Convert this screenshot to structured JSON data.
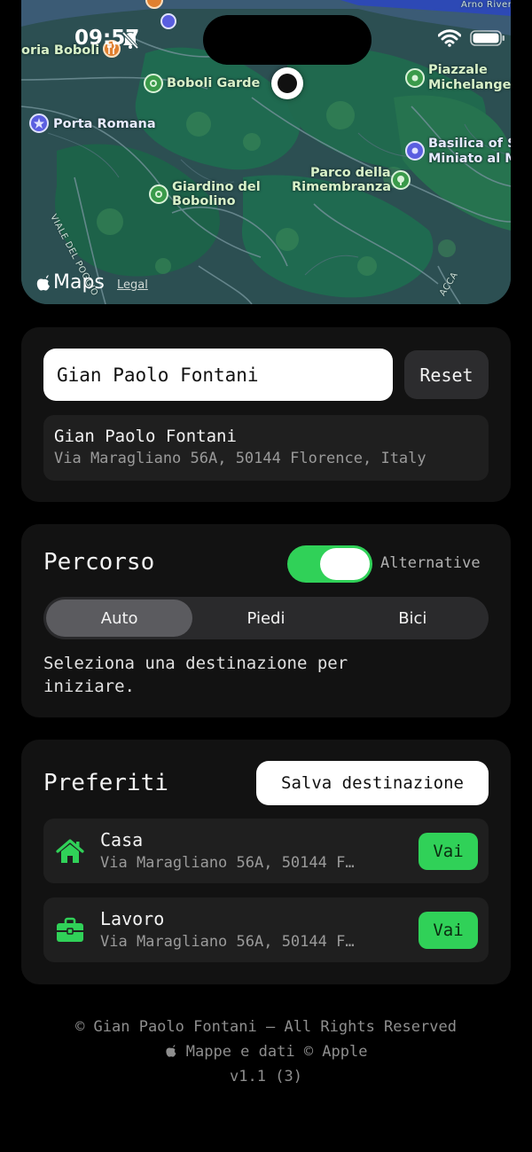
{
  "status": {
    "time": "09:57"
  },
  "map": {
    "labels": {
      "boboli": "Boboli Garde",
      "porta_romana": "Porta Romana",
      "giardino1": "Giardino del",
      "giardino2": "Bobolino",
      "parco1": "Parco della",
      "parco2": "Rimembranza",
      "piazzale1": "Piazzale",
      "piazzale2": "Michelangel",
      "basilica1": "Basilica of S",
      "basilica2": "Miniato al M",
      "oria": "oria Boboli",
      "arno": "Arno River",
      "viale": "VIALE DEL POGGIO",
      "acca": "ACCA"
    },
    "brand": "Maps",
    "legal": "Legal"
  },
  "search": {
    "value": "Gian Paolo Fontani",
    "reset_label": "Reset",
    "result_name": "Gian Paolo Fontani",
    "result_address": "Via Maragliano 56A, 50144 Florence, Italy"
  },
  "route": {
    "title": "Percorso",
    "toggle_label": "Alternative",
    "toggle_on": true,
    "modes": [
      "Auto",
      "Piedi",
      "Bici"
    ],
    "message": "Seleziona una destinazione per iniziare."
  },
  "favorites": {
    "title": "Preferiti",
    "save_label": "Salva destinazione",
    "items": [
      {
        "name": "Casa",
        "address": "Via Maragliano 56A, 50144 F…",
        "action": "Vai"
      },
      {
        "name": "Lavoro",
        "address": "Via Maragliano 56A, 50144 F…",
        "action": "Vai"
      }
    ]
  },
  "footer": {
    "copyright": "© Gian Paolo Fontani — All Rights Reserved",
    "maps_credit": "Mappe e dati © Apple",
    "version": "v1.1 (3)"
  },
  "colors": {
    "accent": "#30d158",
    "card": "#121212",
    "row": "#1f1f1f"
  }
}
